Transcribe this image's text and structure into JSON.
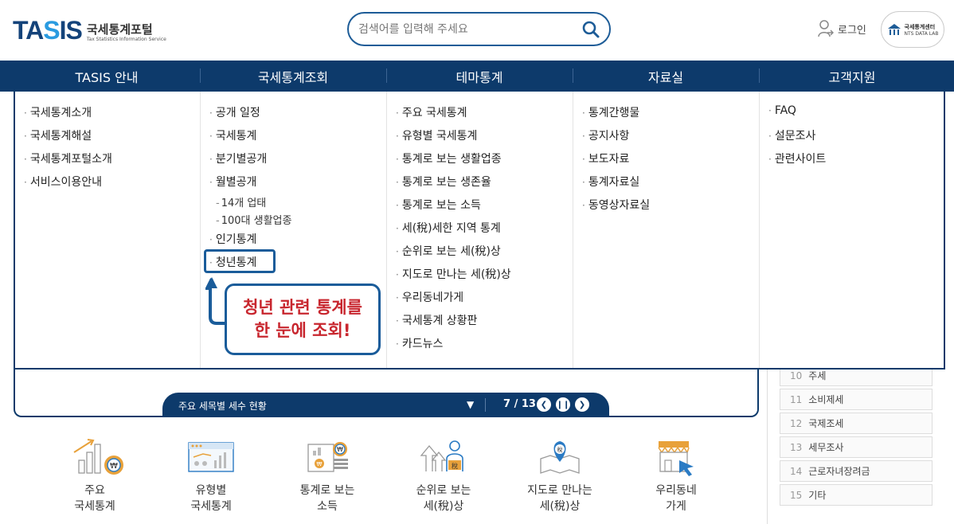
{
  "header": {
    "logo_main_a": "TA",
    "logo_main_b": "S",
    "logo_main_c": "IS",
    "logo_kor": "국세통계포털",
    "logo_eng": "Tax Statistics Information Service",
    "search_placeholder": "검색어를 입력해 주세요",
    "login_label": "로그인",
    "nts_kor": "국세통계센터",
    "nts_eng": "NTS DATA LAB"
  },
  "nav": {
    "tabs": [
      {
        "label": "TASIS 안내"
      },
      {
        "label": "국세통계조회"
      },
      {
        "label": "테마통계"
      },
      {
        "label": "자료실"
      },
      {
        "label": "고객지원"
      }
    ]
  },
  "menu": {
    "col1": [
      "국세통계소개",
      "국세통계해설",
      "국세통계포털소개",
      "서비스이용안내"
    ],
    "col2": [
      "공개 일정",
      "국세통계",
      "분기별공개",
      "월별공개",
      "인기통계",
      "청년통계"
    ],
    "col2_sub": [
      "14개 업태",
      "100대 생활업종"
    ],
    "col3": [
      "주요 국세통계",
      "유형별 국세통계",
      "통계로 보는 생활업종",
      "통계로 보는 생존율",
      "통계로 보는 소득",
      "세(稅)세한 지역 통계",
      "순위로 보는 세(稅)상",
      "지도로 만나는 세(稅)상",
      "우리동네가게",
      "국세통계 상황판",
      "카드뉴스"
    ],
    "col4": [
      "통계간행물",
      "공지사항",
      "보도자료",
      "통계자료실",
      "동영상자료실"
    ],
    "col5": [
      "FAQ",
      "설문조사",
      "관련사이트"
    ]
  },
  "callout": {
    "line1": "청년 관련 통계를",
    "line2": "한 눈에 조회!"
  },
  "banner": {
    "title": "주요 세목별 세수 현황",
    "page": "7 / 13"
  },
  "side_list": [
    {
      "num": "10",
      "label": "주세"
    },
    {
      "num": "11",
      "label": "소비제세"
    },
    {
      "num": "12",
      "label": "국제조세"
    },
    {
      "num": "13",
      "label": "세무조사"
    },
    {
      "num": "14",
      "label": "근로자녀장려금"
    },
    {
      "num": "15",
      "label": "기타"
    }
  ],
  "quick_links": [
    {
      "line1": "주요",
      "line2": "국세통계",
      "icon": "bar-chart-won-icon"
    },
    {
      "line1": "유형별",
      "line2": "국세통계",
      "icon": "dashboard-chart-icon"
    },
    {
      "line1": "통계로 보는",
      "line2": "소득",
      "icon": "income-report-icon"
    },
    {
      "line1": "순위로 보는",
      "line2": "세(稅)상",
      "icon": "ranking-tax-icon"
    },
    {
      "line1": "지도로 만나는",
      "line2": "세(稅)상",
      "icon": "map-tax-icon"
    },
    {
      "line1": "우리동네",
      "line2": "가게",
      "icon": "store-cursor-icon"
    }
  ],
  "colors": {
    "navy": "#0d3a6b",
    "accent_blue": "#2a9be0",
    "callout_red": "#c8262e",
    "icon_orange": "#e8a13a",
    "icon_blue": "#2b7bc4"
  }
}
